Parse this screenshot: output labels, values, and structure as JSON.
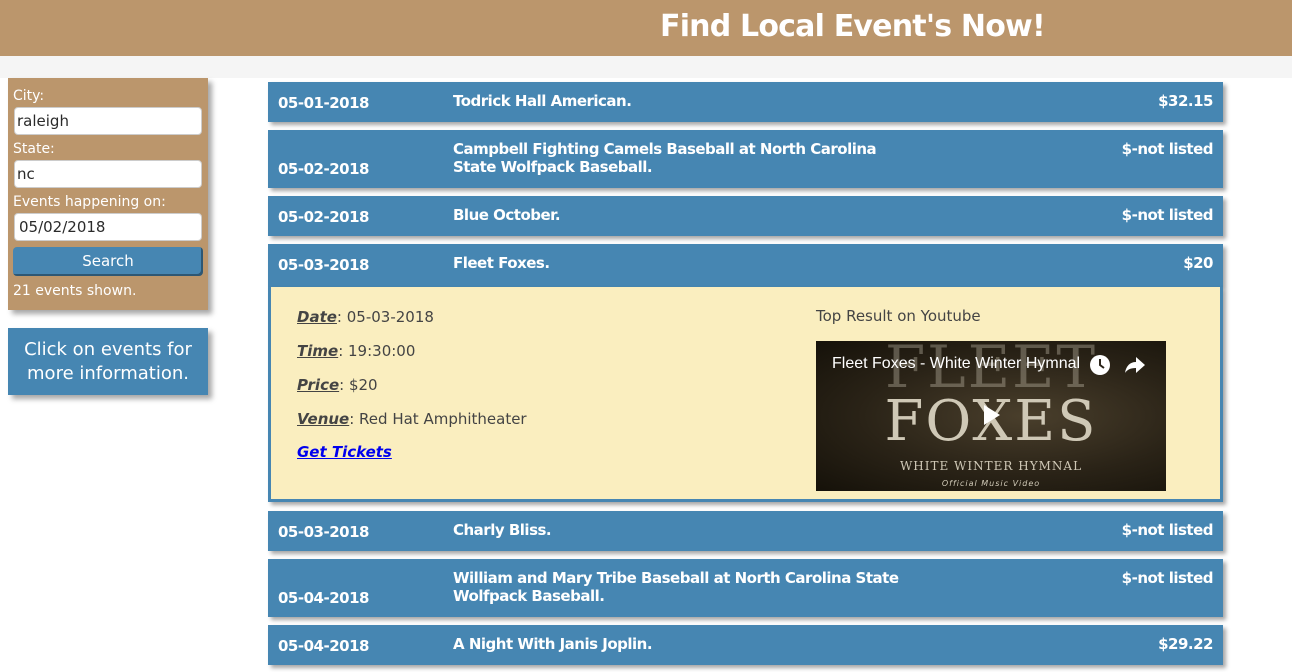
{
  "header": {
    "title": "Find Local Event's Now!"
  },
  "search": {
    "city_label": "City:",
    "city_value": "raleigh",
    "state_label": "State:",
    "state_value": "nc",
    "date_label": "Events happening on:",
    "date_value": "05/02/2018",
    "button_label": "Search",
    "count_text": "21 events shown."
  },
  "info": {
    "text": "Click on events for more information."
  },
  "events": [
    {
      "date": "05-01-2018",
      "name": "Todrick Hall American.",
      "price": "$32.15"
    },
    {
      "date": "05-02-2018",
      "name": "Campbell Fighting Camels Baseball at North Carolina State Wolfpack Baseball.",
      "price": "$-not listed"
    },
    {
      "date": "05-02-2018",
      "name": "Blue October.",
      "price": "$-not listed"
    },
    {
      "date": "05-03-2018",
      "name": "Fleet Foxes.",
      "price": "$20"
    },
    {
      "date": "05-03-2018",
      "name": "Charly Bliss.",
      "price": "$-not listed"
    },
    {
      "date": "05-04-2018",
      "name": "William and Mary Tribe Baseball at North Carolina State Wolfpack Baseball.",
      "price": "$-not listed"
    },
    {
      "date": "05-04-2018",
      "name": "A Night With Janis Joplin.",
      "price": "$29.22"
    }
  ],
  "details": {
    "date_key": "Date",
    "date_value": ": 05-03-2018",
    "time_key": "Time",
    "time_value": ": 19:30:00",
    "price_key": "Price",
    "price_value": ": $20",
    "venue_key": "Venue",
    "venue_value": ": Red Hat Amphitheater",
    "tickets_label": "Get Tickets",
    "youtube_label": "Top Result on Youtube",
    "video_title": "Fleet Foxes - White Winter Hymnal",
    "video_logo_line1": "FLEET",
    "video_logo_line2": "FOXES",
    "video_subtitle": "WHITE WINTER HYMNAL",
    "video_caption": "Official Music Video"
  },
  "colors": {
    "header_bg": "#bb966c",
    "row_bg": "#4686b2",
    "details_bg": "#faeebf"
  }
}
